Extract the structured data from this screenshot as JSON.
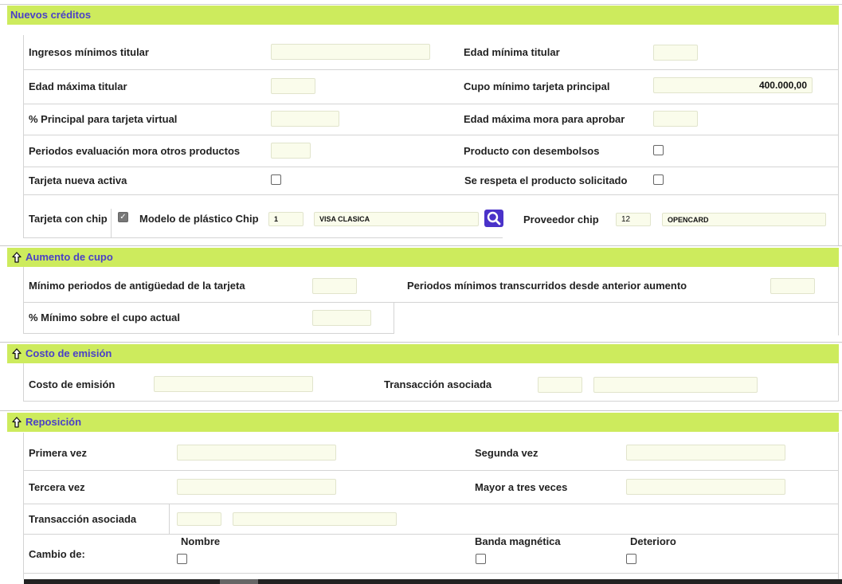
{
  "sections": {
    "nuevos": {
      "title": "Nuevos créditos",
      "ingresos_minimos_titular": "Ingresos mínimos titular",
      "edad_minima_titular": "Edad mínima titular",
      "edad_maxima_titular": "Edad máxima titular",
      "cupo_minimo_tarjeta_principal": "Cupo mínimo tarjeta principal",
      "cupo_minimo_value": "400.000,00",
      "pct_principal_virtual": "% Principal para tarjeta virtual",
      "edad_maxima_mora": "Edad máxima mora para aprobar",
      "periodos_evaluacion_mora": "Periodos evaluación mora otros productos",
      "producto_con_desembolsos": "Producto con desembolsos",
      "tarjeta_nueva_activa": "Tarjeta nueva activa",
      "se_respeta_producto": "Se respeta el producto solicitado",
      "tarjeta_con_chip": "Tarjeta con chip",
      "modelo_plastico_chip": "Modelo de plástico Chip",
      "modelo_code": "1",
      "modelo_name": "VISA CLASICA",
      "proveedor_chip": "Proveedor chip",
      "proveedor_code": "12",
      "proveedor_name": "OPENCARD"
    },
    "aumento": {
      "title": "Aumento de cupo",
      "minimo_periodos_antiguedad": "Mínimo periodos de antigüedad de la tarjeta",
      "periodos_minimos_transcurridos": "Periodos mínimos transcurridos desde anterior aumento",
      "pct_minimo_cupo": "% Mínimo sobre el cupo actual"
    },
    "costo": {
      "title": "Costo de emisión",
      "costo_emision": "Costo de emisión",
      "transaccion_asociada": "Transacción asociada"
    },
    "reposicion": {
      "title": "Reposición",
      "primera_vez": "Primera vez",
      "segunda_vez": "Segunda vez",
      "tercera_vez": "Tercera vez",
      "mayor_tres_veces": "Mayor a tres veces",
      "transaccion_asociada": "Transacción asociada",
      "cambio_de": "Cambio de:",
      "nombre": "Nombre",
      "banda_magnetica": "Banda magnética",
      "deterioro": "Deterioro"
    }
  },
  "checkboxes": {
    "producto_con_desembolsos": false,
    "tarjeta_nueva_activa": false,
    "se_respeta_producto": false,
    "tarjeta_con_chip": true,
    "cambio_nombre": false,
    "cambio_banda": false,
    "cambio_deterioro": false
  },
  "colors": {
    "section_header_bg": "#cdeb5d",
    "section_title": "#4a3fc8",
    "input_bg": "#fafceb",
    "search_button": "#4a32c9"
  },
  "icons": {
    "collapse": "arrow-up-icon",
    "search": "search-icon"
  }
}
